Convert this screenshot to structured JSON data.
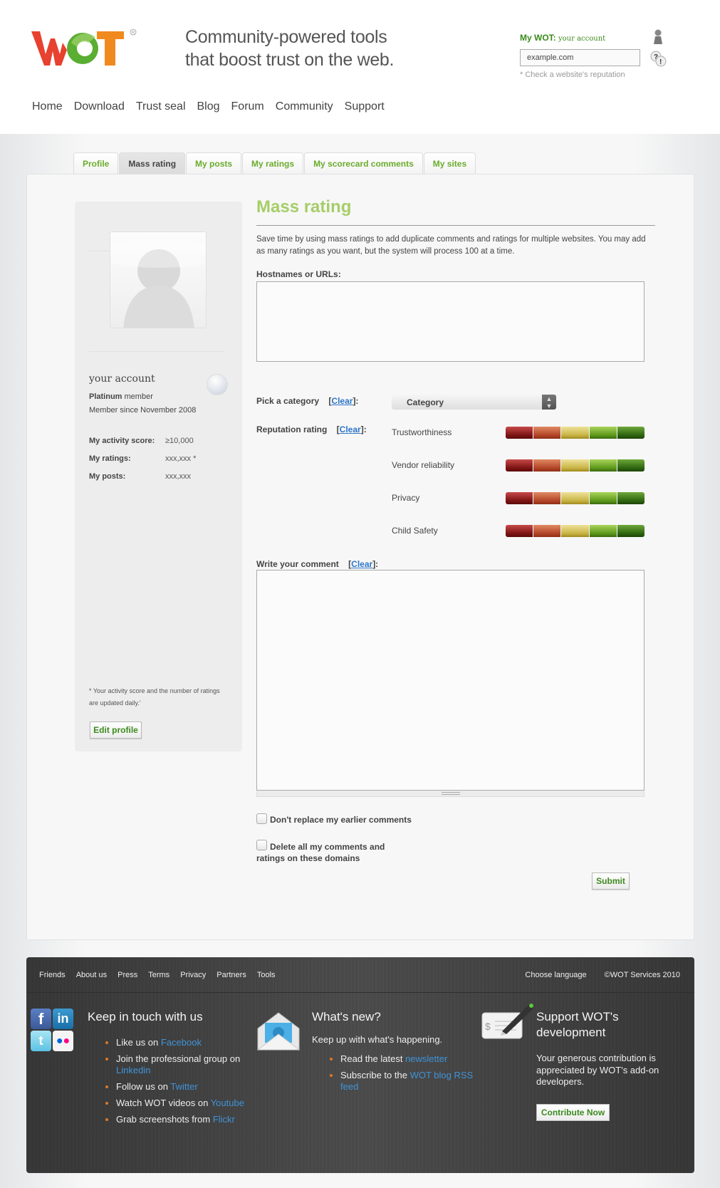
{
  "header": {
    "logo_text": "WOT",
    "tagline_line1": "Community-powered tools",
    "tagline_line2": "that boost trust on the web.",
    "mywot_label": "My WOT:",
    "mywot_account": "your account",
    "site_input_value": "example.com",
    "check_note": "* Check a website's reputation",
    "nav": [
      "Home",
      "Download",
      "Trust seal",
      "Blog",
      "Forum",
      "Community",
      "Support"
    ]
  },
  "tabs": [
    {
      "label": "Profile",
      "active": false
    },
    {
      "label": "Mass rating",
      "active": true
    },
    {
      "label": "My posts",
      "active": false
    },
    {
      "label": "My ratings",
      "active": false
    },
    {
      "label": "My scorecard comments",
      "active": false
    },
    {
      "label": "My sites",
      "active": false
    }
  ],
  "sidebar": {
    "account_name": "your account",
    "membership_level": "Platinum",
    "membership_suffix": " member",
    "member_since": "Member since November 2008",
    "stats": [
      {
        "label": "My activity score:",
        "value": "≥10,000"
      },
      {
        "label": "My ratings:",
        "value": "xxx,xxx *"
      },
      {
        "label": "My posts:",
        "value": "xxx,xxx"
      }
    ],
    "footnote": "* Your activity score and the number of ratings are updated daily.'",
    "edit_profile_label": "Edit profile"
  },
  "main": {
    "title": "Mass rating",
    "intro": "Save time by using mass ratings to add duplicate comments and ratings for multiple websites. You may add as many ratings as you want, but the system will process 100 at a time.",
    "hostnames_label": "Hostnames or URLs:",
    "hostnames_value": "",
    "category_label": "Pick a category",
    "clear_label": "Clear",
    "category_selected": "Category",
    "reputation_label": "Reputation rating",
    "ratings": [
      {
        "name": "Trustworthiness"
      },
      {
        "name": "Vendor reliability"
      },
      {
        "name": "Privacy"
      },
      {
        "name": "Child Safety"
      }
    ],
    "comment_label": "Write your comment",
    "comment_value": "",
    "checkbox_dont_replace": "Don't replace my earlier comments",
    "checkbox_delete_line1": "Delete all my comments and",
    "checkbox_delete_line2": "ratings on these domains",
    "submit_label": "Submit"
  },
  "footer": {
    "links": [
      "Friends",
      "About us",
      "Press",
      "Terms",
      "Privacy",
      "Partners",
      "Tools"
    ],
    "choose_language": "Choose language",
    "copyright": "©WOT Services 2010",
    "keep_in_touch": {
      "title": "Keep in touch with us",
      "items": [
        {
          "text": "Like us on ",
          "link": "Facebook"
        },
        {
          "text": "Join the professional group on ",
          "link": "Linkedin"
        },
        {
          "text": "Follow us on ",
          "link": "Twitter"
        },
        {
          "text": "Watch WOT videos on ",
          "link": "Youtube"
        },
        {
          "text": "Grab screenshots from ",
          "link": "Flickr"
        }
      ]
    },
    "whats_new": {
      "title": "What's new?",
      "subtitle": "Keep up with what's happening.",
      "items": [
        {
          "text": "Read the latest ",
          "link": "newsletter"
        },
        {
          "text": "Subscribe to the ",
          "link": "WOT blog RSS feed"
        }
      ]
    },
    "support": {
      "title_line1": "Support WOT's",
      "title_line2": "development",
      "text": "Your generous contribution is appreciated by WOT's add-on developers.",
      "button_label": "Contribute Now"
    }
  },
  "colors": {
    "brand_green": "#3b8a1c",
    "title_green": "#a6cd68",
    "tab_green": "#6aac2c",
    "link_blue": "#2d75c9",
    "footer_link_blue": "#3f93d8"
  }
}
